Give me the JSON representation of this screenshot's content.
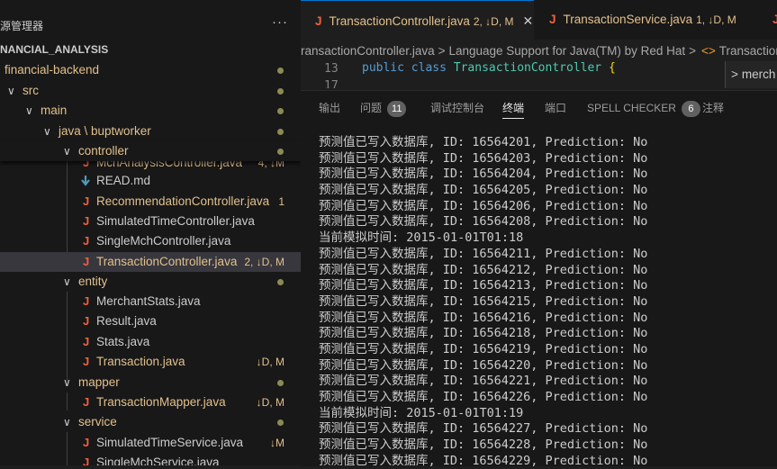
{
  "sidebar": {
    "title": "源管理器",
    "more": "···",
    "project": "NANCIAL_ANALYSIS",
    "tree": [
      {
        "label": "financial-backend",
        "badge": "",
        "dot": true
      },
      {
        "label": "src",
        "badge": "",
        "dot": true
      },
      {
        "label": "main",
        "badge": "",
        "dot": true
      },
      {
        "label": "java \\ buptworker",
        "badge": "",
        "dot": true
      },
      {
        "label": "controller",
        "badge": "",
        "dot": true
      },
      {
        "label": "MchAnalysisController.java",
        "badge": "4, ↓M",
        "dot": false
      },
      {
        "label": "READ.md",
        "badge": "",
        "dot": false
      },
      {
        "label": "RecommendationController.java",
        "badge": "1",
        "dot": false
      },
      {
        "label": "SimulatedTimeController.java",
        "badge": "",
        "dot": false
      },
      {
        "label": "SingleMchController.java",
        "badge": "",
        "dot": false
      },
      {
        "label": "TransactionController.java",
        "badge": "2, ↓D, M",
        "dot": false
      },
      {
        "label": "entity",
        "badge": "",
        "dot": true
      },
      {
        "label": "MerchantStats.java",
        "badge": "",
        "dot": false
      },
      {
        "label": "Result.java",
        "badge": "",
        "dot": false
      },
      {
        "label": "Stats.java",
        "badge": "",
        "dot": false
      },
      {
        "label": "Transaction.java",
        "badge": "↓D, M",
        "dot": false
      },
      {
        "label": "mapper",
        "badge": "",
        "dot": true
      },
      {
        "label": "TransactionMapper.java",
        "badge": "↓D, M",
        "dot": false
      },
      {
        "label": "service",
        "badge": "",
        "dot": true
      },
      {
        "label": "SimulatedTimeService.java",
        "badge": "↓M",
        "dot": false
      },
      {
        "label": "SingleMchService.java",
        "badge": "",
        "dot": false
      }
    ]
  },
  "editor": {
    "tabs": [
      {
        "label": "TransactionController.java",
        "status": "2, ↓D, M",
        "close": "✕"
      },
      {
        "label": "TransactionService.java",
        "status": "1, ↓D, M"
      },
      {
        "label": ""
      }
    ],
    "breadcrumb": {
      "file": "ransactionController.java",
      "support": "Language Support for Java(TM) by Red Hat",
      "symbol": "TransactionCo"
    },
    "code": {
      "line_number": "13",
      "next_line_number": "17",
      "kw1": "public",
      "kw2": "class",
      "class_name": "TransactionController",
      "brace": "{"
    },
    "outline_widget": "merch"
  },
  "panel": {
    "tabs": [
      {
        "label": "输出"
      },
      {
        "label": "问题",
        "count": "11"
      },
      {
        "label": "调试控制台"
      },
      {
        "label": "终端",
        "active": true
      },
      {
        "label": "端口"
      },
      {
        "label": "SPELL CHECKER",
        "count": "6"
      },
      {
        "label": "注释"
      }
    ],
    "terminal_lines": [
      "预测值已写入数据库, ID: 16564201, Prediction: No",
      "预测值已写入数据库, ID: 16564203, Prediction: No",
      "预测值已写入数据库, ID: 16564204, Prediction: No",
      "预测值已写入数据库, ID: 16564205, Prediction: No",
      "预测值已写入数据库, ID: 16564206, Prediction: No",
      "预测值已写入数据库, ID: 16564208, Prediction: No",
      "当前模拟时间: 2015-01-01T01:18",
      "预测值已写入数据库, ID: 16564211, Prediction: No",
      "预测值已写入数据库, ID: 16564212, Prediction: No",
      "预测值已写入数据库, ID: 16564213, Prediction: No",
      "预测值已写入数据库, ID: 16564215, Prediction: No",
      "预测值已写入数据库, ID: 16564216, Prediction: No",
      "预测值已写入数据库, ID: 16564218, Prediction: No",
      "预测值已写入数据库, ID: 16564219, Prediction: No",
      "预测值已写入数据库, ID: 16564220, Prediction: No",
      "预测值已写入数据库, ID: 16564221, Prediction: No",
      "预测值已写入数据库, ID: 16564226, Prediction: No",
      "当前模拟时间: 2015-01-01T01:19",
      "预测值已写入数据库, ID: 16564227, Prediction: No",
      "预测值已写入数据库, ID: 16564228, Prediction: No",
      "预测值已写入数据库, ID: 16564229, Prediction: No"
    ]
  },
  "colors": {
    "accent": "#0078d4",
    "modified": "#e2c08d",
    "java_icon": "#f06040",
    "folder_text": "#e2c08d"
  }
}
